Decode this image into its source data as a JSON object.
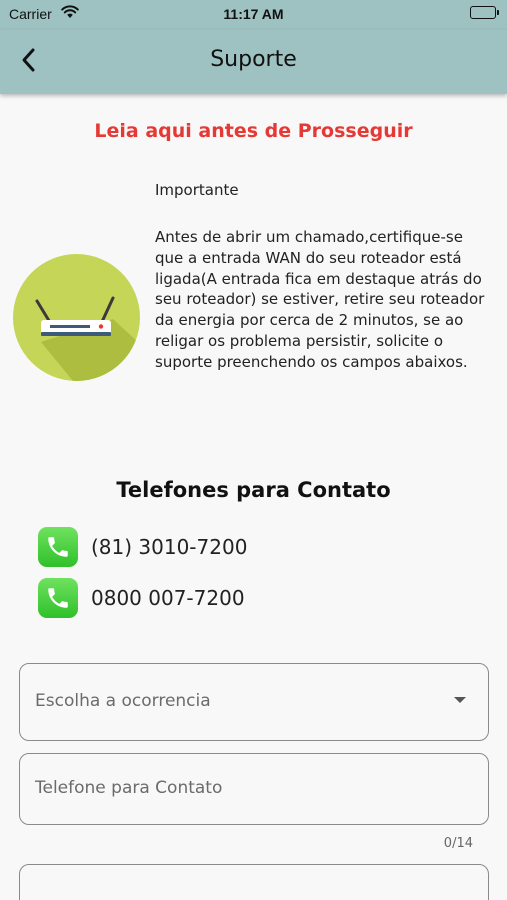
{
  "status_bar": {
    "carrier": "Carrier",
    "time": "11:17 AM"
  },
  "app_bar": {
    "title": "Suporte",
    "back_icon": "chevron-left-icon"
  },
  "warning": {
    "title": "Leia aqui antes de Prosseguir",
    "color": "#e53935"
  },
  "info": {
    "heading": "Importante",
    "body": "Antes de abrir um chamado,certifique-se que a entrada WAN do seu roteador está ligada(A entrada fica em destaque atrás do seu roteador) se estiver, retire seu roteador da energia por cerca de 2 minutos, se ao religar os problema persistir, solicite o suporte preenchendo os campos abaixos.",
    "image_icon": "router-icon"
  },
  "contacts": {
    "title": "Telefones para Contato",
    "phones": [
      {
        "number": "(81) 3010-7200",
        "icon": "phone-icon"
      },
      {
        "number": "0800 007-7200",
        "icon": "phone-icon"
      }
    ]
  },
  "form": {
    "occurrence": {
      "placeholder": "Escolha a ocorrencia"
    },
    "phone": {
      "placeholder": "Telefone para Contato",
      "counter": "0/14"
    }
  },
  "colors": {
    "app_bar": "#9ec1c1",
    "router_bg": "#c5d557",
    "phone_icon": "#3fcf36"
  }
}
